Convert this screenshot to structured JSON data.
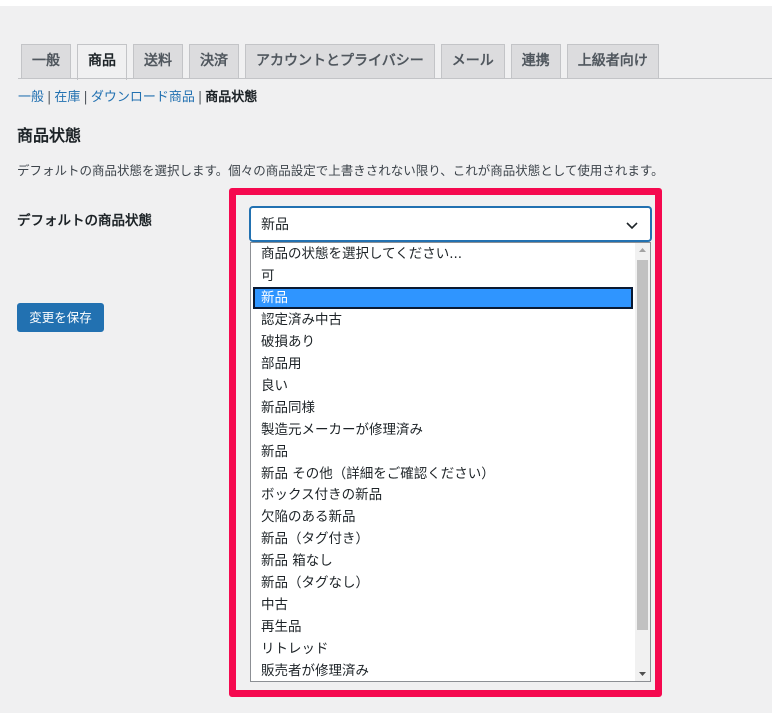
{
  "tabs": [
    {
      "label": "一般",
      "active": false
    },
    {
      "label": "商品",
      "active": true
    },
    {
      "label": "送料",
      "active": false
    },
    {
      "label": "決済",
      "active": false
    },
    {
      "label": "アカウントとプライバシー",
      "active": false
    },
    {
      "label": "メール",
      "active": false
    },
    {
      "label": "連携",
      "active": false
    },
    {
      "label": "上級者向け",
      "active": false
    }
  ],
  "subnav": {
    "items": [
      "一般",
      "在庫",
      "ダウンロード商品"
    ],
    "current": "商品状態",
    "separator": "|"
  },
  "page": {
    "title": "商品状態",
    "description": "デフォルトの商品状態を選択します。個々の商品設定で上書きされない限り、これが商品状態として使用されます。",
    "field_label": "デフォルトの商品状態",
    "save_label": "変更を保存"
  },
  "select": {
    "value": "新品",
    "selected_index": 2,
    "options": [
      "商品の状態を選択してください...",
      "可",
      "新品",
      "認定済み中古",
      "破損あり",
      "部品用",
      "良い",
      "新品同様",
      "製造元メーカーが修理済み",
      "新品",
      "新品 その他（詳細をご確認ください）",
      "ボックス付きの新品",
      "欠陥のある新品",
      "新品（タグ付き）",
      "新品 箱なし",
      "新品（タグなし）",
      "中古",
      "再生品",
      "リトレッド",
      "販売者が修理済み"
    ]
  },
  "colors": {
    "accent": "#2271b1",
    "highlight": "#f5094f",
    "selected_option": "#2f95ff"
  }
}
